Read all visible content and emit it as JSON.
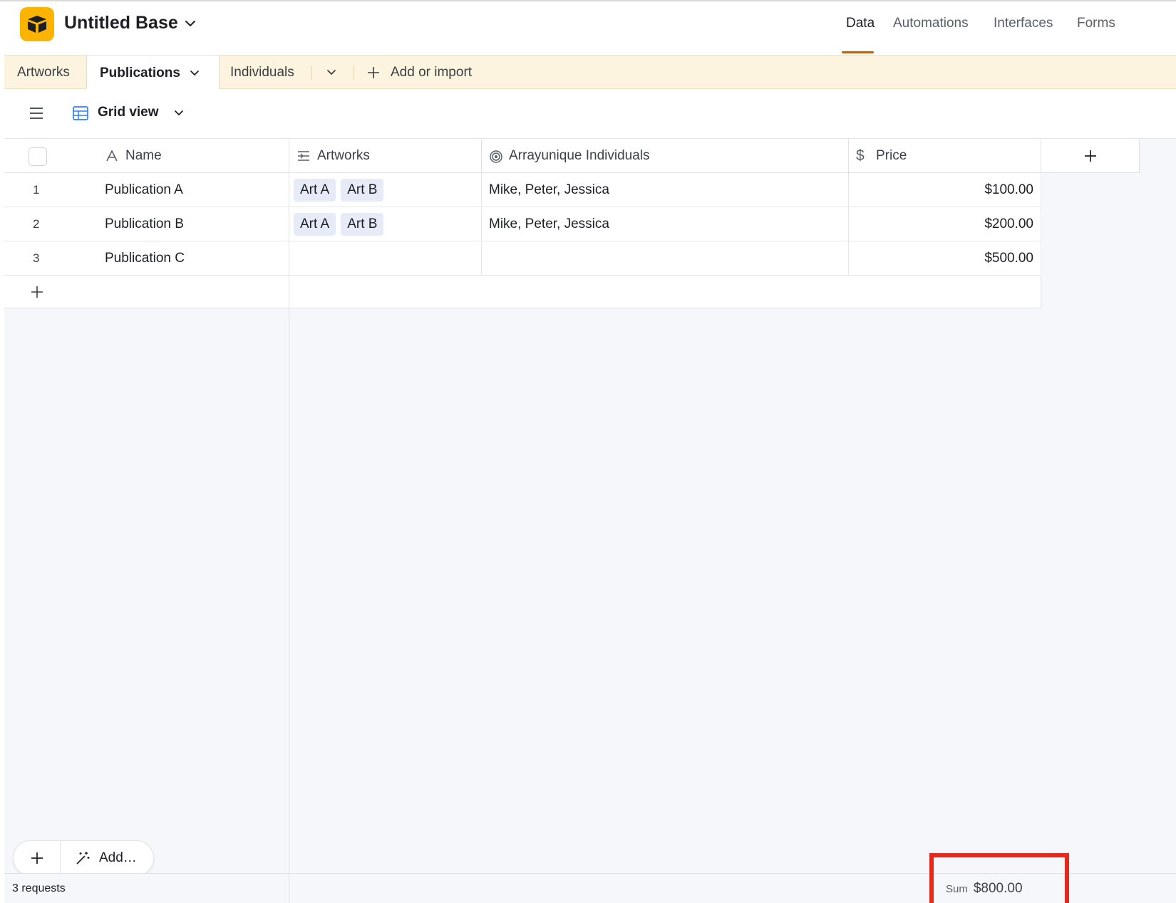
{
  "header": {
    "base_title": "Untitled Base",
    "nav": [
      "Data",
      "Automations",
      "Interfaces",
      "Forms"
    ],
    "active_nav": "Data",
    "accent_color": "#b5631b",
    "logo_color": "#fcb400"
  },
  "tabs": {
    "items": [
      "Artworks",
      "Publications",
      "Individuals"
    ],
    "active": "Publications",
    "add_label": "Add or import"
  },
  "view": {
    "name": "Grid view"
  },
  "table": {
    "columns": [
      "Name",
      "Artworks",
      "Arrayunique Individuals",
      "Price"
    ],
    "rows": [
      {
        "num": "1",
        "name": "Publication A",
        "artworks": [
          "Art A",
          "Art B"
        ],
        "individuals": "Mike, Peter, Jessica",
        "price": "$100.00"
      },
      {
        "num": "2",
        "name": "Publication B",
        "artworks": [
          "Art A",
          "Art B"
        ],
        "individuals": "Mike, Peter, Jessica",
        "price": "$200.00"
      },
      {
        "num": "3",
        "name": "Publication C",
        "artworks": [],
        "individuals": "",
        "price": "$500.00"
      }
    ]
  },
  "footer": {
    "add_label": "Add…",
    "requests": "3 requests",
    "sum_label": "Sum",
    "sum_value": "$800.00"
  }
}
